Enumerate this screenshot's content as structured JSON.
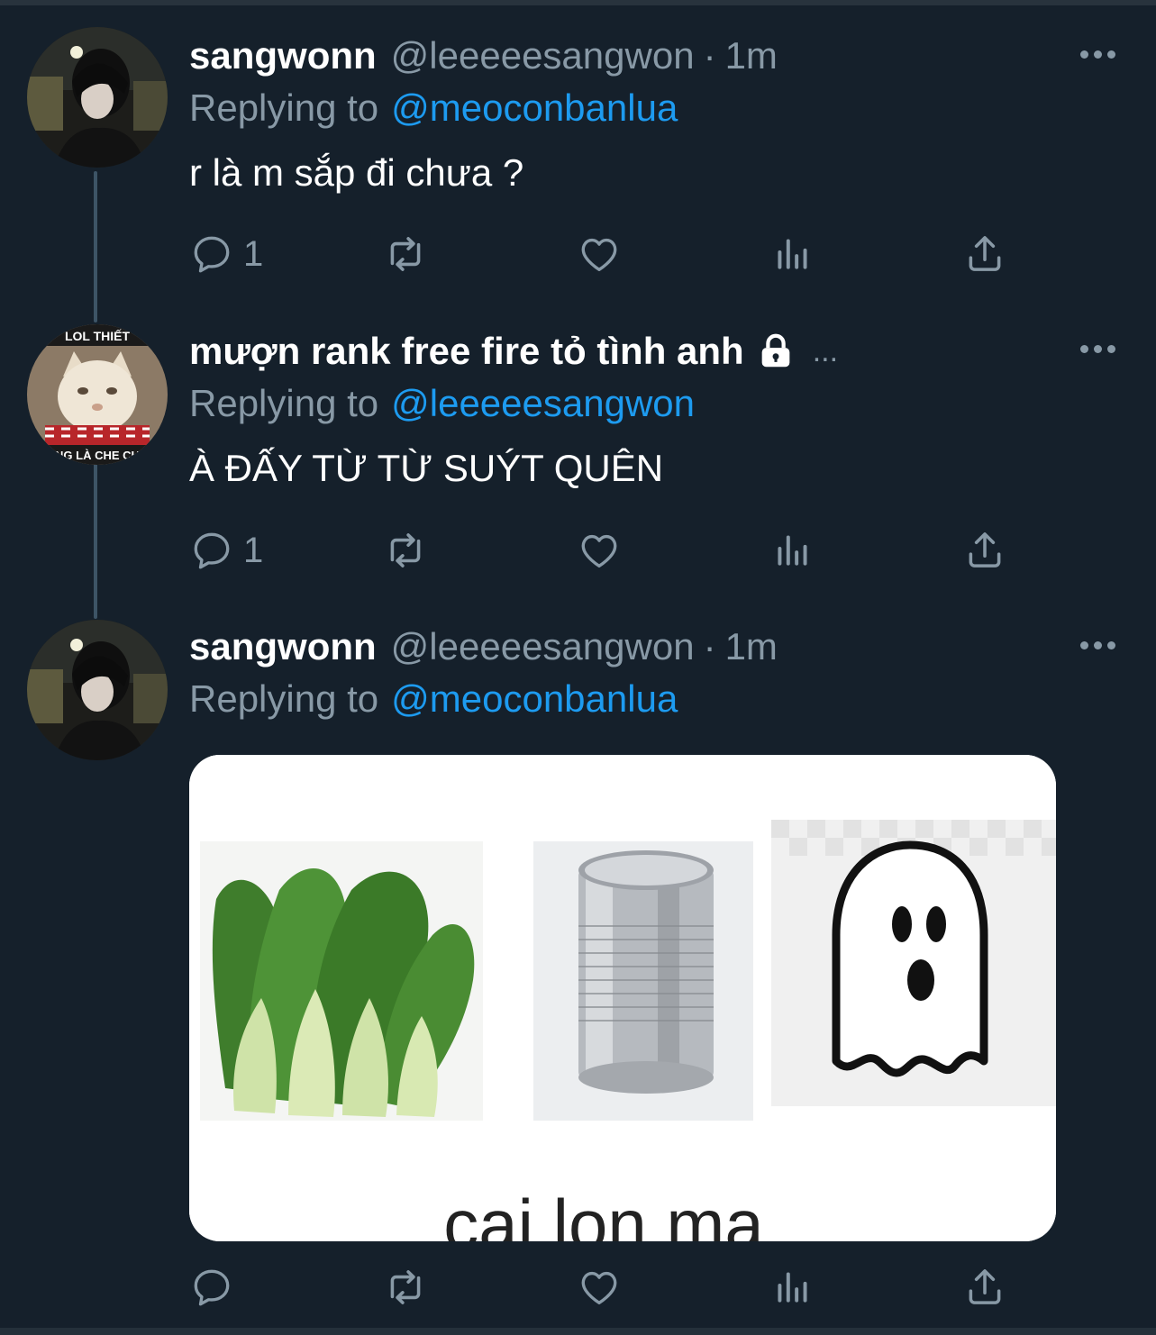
{
  "tweets": [
    {
      "name": "sangwonn",
      "handle": "@leeeeesangwon",
      "separator": "·",
      "time": "1m",
      "reply_label": "Replying to",
      "reply_to": "@meoconbanlua",
      "text": "r là m sắp đi chưa ?",
      "avatar_icon": "avatar-photo-person",
      "actions": {
        "reply_count": "1",
        "retweet_count": "",
        "like_count": ""
      }
    },
    {
      "name": "mượn rank free fire tỏ tình anh",
      "name_icon": "lock-icon",
      "name_truncation": "...",
      "reply_label": "Replying to",
      "reply_to": "@leeeeesangwon",
      "text": "À ĐẤY TỪ TỪ SUÝT QUÊN",
      "avatar_icon": "avatar-cat-meme",
      "avatar_caption_top": "LOL THIẾT",
      "avatar_caption_bottom": "NG LÀ CHE CH",
      "actions": {
        "reply_count": "1",
        "retweet_count": "",
        "like_count": ""
      }
    },
    {
      "name": "sangwonn",
      "handle": "@leeeeesangwon",
      "separator": "·",
      "time": "1m",
      "reply_label": "Replying to",
      "reply_to": "@meoconbanlua",
      "avatar_icon": "avatar-photo-person",
      "media": {
        "caption": "cai lon ma",
        "panels": [
          "bok-choy-image",
          "tin-can-image",
          "ghost-emoji-image"
        ]
      },
      "actions": {
        "reply_count": "",
        "retweet_count": "",
        "like_count": ""
      }
    }
  ],
  "colors": {
    "background": "#15202b",
    "text_primary": "#ffffff",
    "text_secondary": "#8899a6",
    "link": "#1d9bf0",
    "thread_line": "#3d5466"
  }
}
